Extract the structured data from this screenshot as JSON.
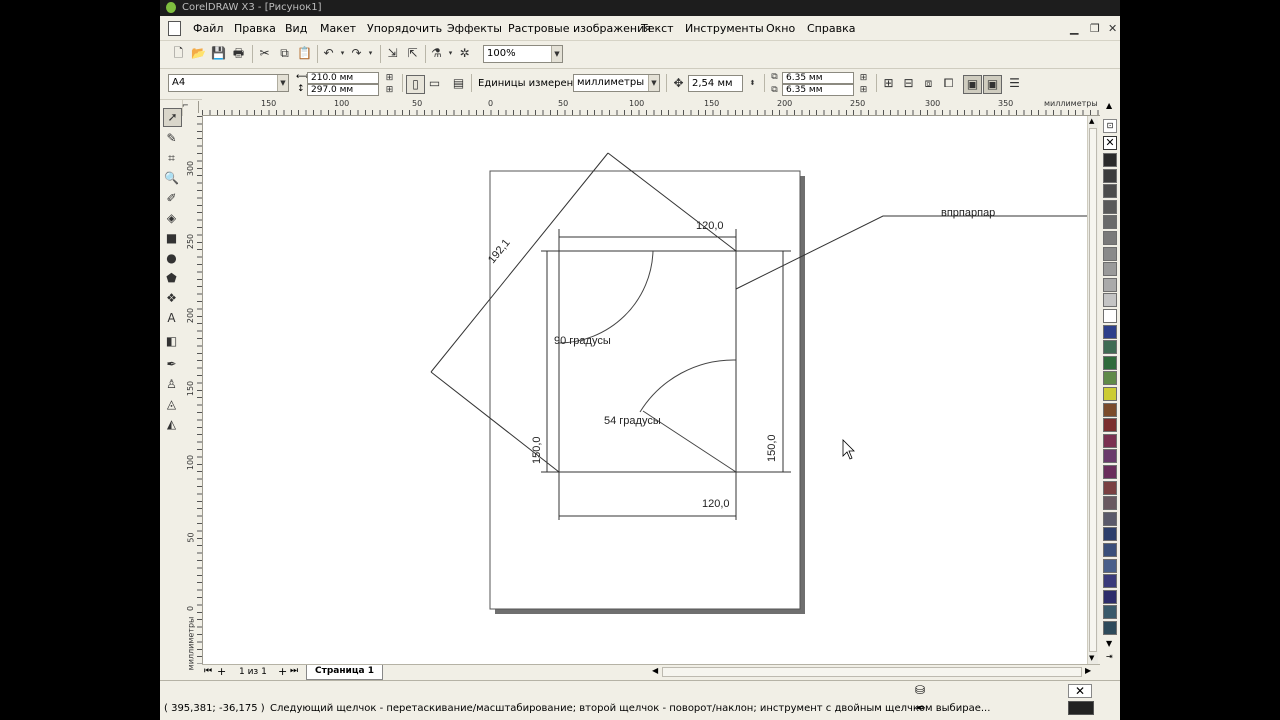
{
  "window": {
    "title": "CorelDRAW X3 - [Рисунок1]"
  },
  "menu": {
    "items": [
      "Файл",
      "Правка",
      "Вид",
      "Макет",
      "Упорядочить",
      "Эффекты",
      "Растровые изображения",
      "Текст",
      "Инструменты",
      "Окно",
      "Справка"
    ]
  },
  "standard_toolbar": {
    "zoom": "100%"
  },
  "property_bar": {
    "paper_size": "A4",
    "width": "210.0 мм",
    "height": "297.0 мм",
    "units_label": "Единицы измерения:",
    "units_value": "миллиметры",
    "nudge": "2,54 мм",
    "dup_x": "6.35 мм",
    "dup_y": "6.35 мм"
  },
  "ruler": {
    "h_labels": [
      "150",
      "100",
      "50",
      "0",
      "50",
      "100",
      "150",
      "200",
      "250",
      "300",
      "350"
    ],
    "h_unit": "миллиметры",
    "v_labels": [
      "300",
      "250",
      "200",
      "150",
      "100",
      "50",
      "0"
    ],
    "v_unit": "миллиметры"
  },
  "drawing": {
    "dim_top": "120,0",
    "dim_bottom": "120,0",
    "dim_left": "150,0",
    "dim_right": "150,0",
    "dim_diag": "192,1",
    "angle1": "90 градусы",
    "angle2": "54 градусы",
    "callout": "впрпарпар"
  },
  "page_nav": {
    "counter": "1 из 1",
    "tab": "Страница 1"
  },
  "status": {
    "coords": "( 395,381; -36,175 )",
    "hint": "Следующий щелчок - перетаскивание/масштабирование; второй щелчок - поворот/наклон; инструмент с двойным щелчком выбирае..."
  },
  "palette": {
    "colors": [
      "#2b2b2b",
      "#3c3c3c",
      "#4c4c4c",
      "#5a5a5a",
      "#6a6a6a",
      "#7a7a7a",
      "#8a8a8a",
      "#9a9a9a",
      "#aaaaaa",
      "#c4c4c4",
      "#ffffff",
      "#2d3f8a",
      "#3f6b53",
      "#2f6a3a",
      "#5f8a48",
      "#cccc33",
      "#7a4a2a",
      "#7a2d2d",
      "#7a3050",
      "#6a3a6a",
      "#6a2d5a",
      "#7a4040",
      "#6a5a60",
      "#5a5a6a",
      "#2d3f6a",
      "#3a4f7a",
      "#4a5f8a",
      "#3a3a7a",
      "#2d2d6a",
      "#3a5a6a",
      "#2d4a5a"
    ]
  }
}
